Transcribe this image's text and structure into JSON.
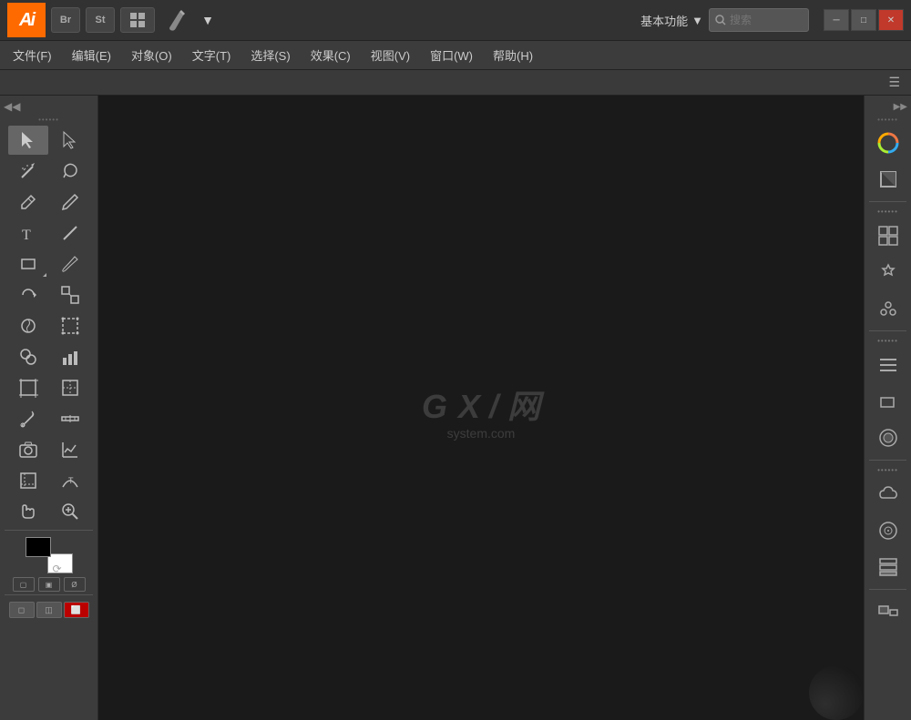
{
  "app": {
    "logo": "Ai",
    "logo_color": "#FF6A00"
  },
  "title_bar": {
    "bridge_btn": "Br",
    "stock_btn": "St",
    "workspace_label": "基本功能",
    "search_placeholder": "搜索",
    "minimize_symbol": "─",
    "restore_symbol": "□",
    "close_symbol": "✕"
  },
  "menu_bar": {
    "items": [
      {
        "label": "文件(F)"
      },
      {
        "label": "编辑(E)"
      },
      {
        "label": "对象(O)"
      },
      {
        "label": "文字(T)"
      },
      {
        "label": "选择(S)"
      },
      {
        "label": "效果(C)"
      },
      {
        "label": "视图(V)"
      },
      {
        "label": "窗口(W)"
      },
      {
        "label": "帮助(H)"
      }
    ]
  },
  "canvas": {
    "watermark_main": "GXI网",
    "watermark_sub": "system.com",
    "background": "#0d0d0d"
  },
  "tools": {
    "rows": [
      [
        "▶",
        "▷"
      ],
      [
        "✳",
        "⊛"
      ],
      [
        "✒",
        "✏"
      ],
      [
        "T",
        "/"
      ],
      [
        "■",
        "/"
      ],
      [
        "✦",
        "⌐"
      ],
      [
        "↺",
        "⤢"
      ],
      [
        "⚓",
        "⊞"
      ],
      [
        "⊙",
        "▦"
      ],
      [
        "◈",
        "⊡"
      ],
      [
        "⊚",
        "☡"
      ],
      [
        "☐",
        "✎"
      ],
      [
        "✋",
        "🔍"
      ]
    ]
  },
  "right_panel": {
    "icons": [
      "🎨",
      "◩",
      "▦",
      "🌿",
      "♣",
      "≡",
      "□",
      "⬤",
      "☁",
      "⊙",
      "⬛",
      "📚"
    ]
  }
}
